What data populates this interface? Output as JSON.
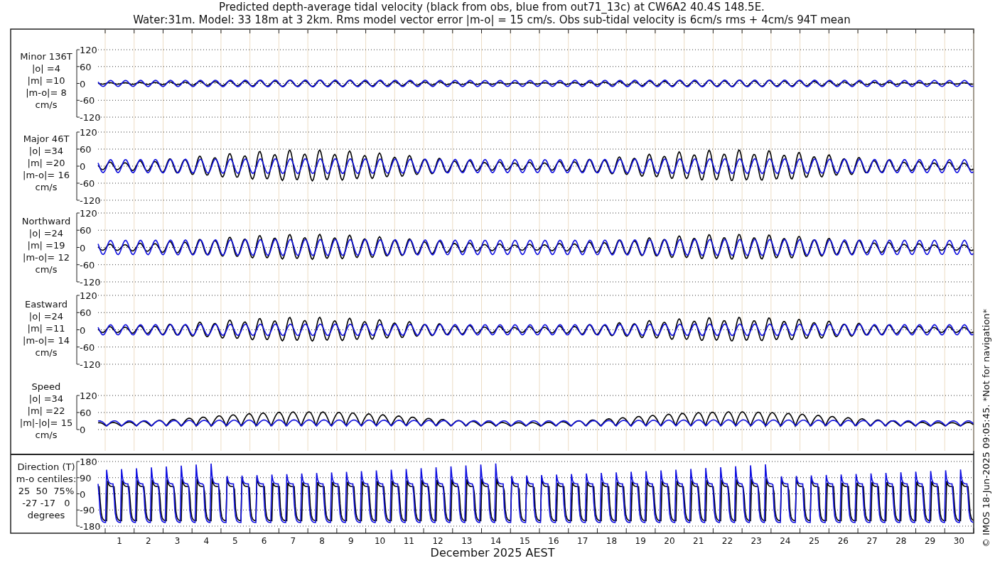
{
  "title_lines": [
    "Predicted depth-average tidal velocity (black from obs, blue from out71_13c) at CW6A2 40.4S 148.5E.",
    "Water:31m. Model: 33 18m at 3 2km. Rms model vector error |m-o| = 15 cm/s. Obs sub-tidal velocity is 6cm/s rms + 4cm/s 94T mean"
  ],
  "panels": [
    {
      "kind": "velocity",
      "label_lines": [
        "Minor 136T",
        "|o| =4",
        "|m| =10",
        "|m-o|= 8",
        "cm/s"
      ],
      "yticks": [
        "120",
        "60",
        "0",
        "-60",
        "-120"
      ]
    },
    {
      "kind": "velocity",
      "label_lines": [
        "Major 46T",
        "|o| =34",
        "|m| =20",
        "|m-o|= 16",
        "cm/s"
      ],
      "yticks": [
        "120",
        "60",
        "0",
        "-60",
        "-120"
      ]
    },
    {
      "kind": "velocity",
      "label_lines": [
        "Northward",
        "|o| =24",
        "|m| =19",
        "|m-o|= 12",
        "cm/s"
      ],
      "yticks": [
        "120",
        "60",
        "0",
        "-60",
        "-120"
      ]
    },
    {
      "kind": "velocity",
      "label_lines": [
        "Eastward",
        "|o| =24",
        "|m| =11",
        "|m-o|= 14",
        "cm/s"
      ],
      "yticks": [
        "120",
        "60",
        "0",
        "-60",
        "-120"
      ]
    },
    {
      "kind": "speed",
      "label_lines": [
        "Speed",
        "|o| =34",
        "|m| =22",
        "|m|-|o|= 15",
        "cm/s"
      ],
      "yticks": [
        "120",
        "60",
        "0"
      ]
    },
    {
      "kind": "direction",
      "label_lines": [
        "Direction (T)",
        "m-o centiles:",
        "25  50  75%",
        "-27 -17   0",
        "degrees"
      ],
      "yticks": [
        "180",
        "90",
        "0",
        "-90",
        "-180"
      ]
    }
  ],
  "x_axis": {
    "labels": [
      "1",
      "2",
      "3",
      "4",
      "5",
      "6",
      "7",
      "8",
      "9",
      "10",
      "11",
      "12",
      "13",
      "14",
      "15",
      "16",
      "17",
      "18",
      "19",
      "20",
      "21",
      "22",
      "23",
      "24",
      "25",
      "26",
      "27",
      "28",
      "29",
      "30"
    ],
    "title": "December 2025 AEST"
  },
  "side_note": "© IMOS 18-Jun-2025 09:05:45. *Not for navigation*"
}
